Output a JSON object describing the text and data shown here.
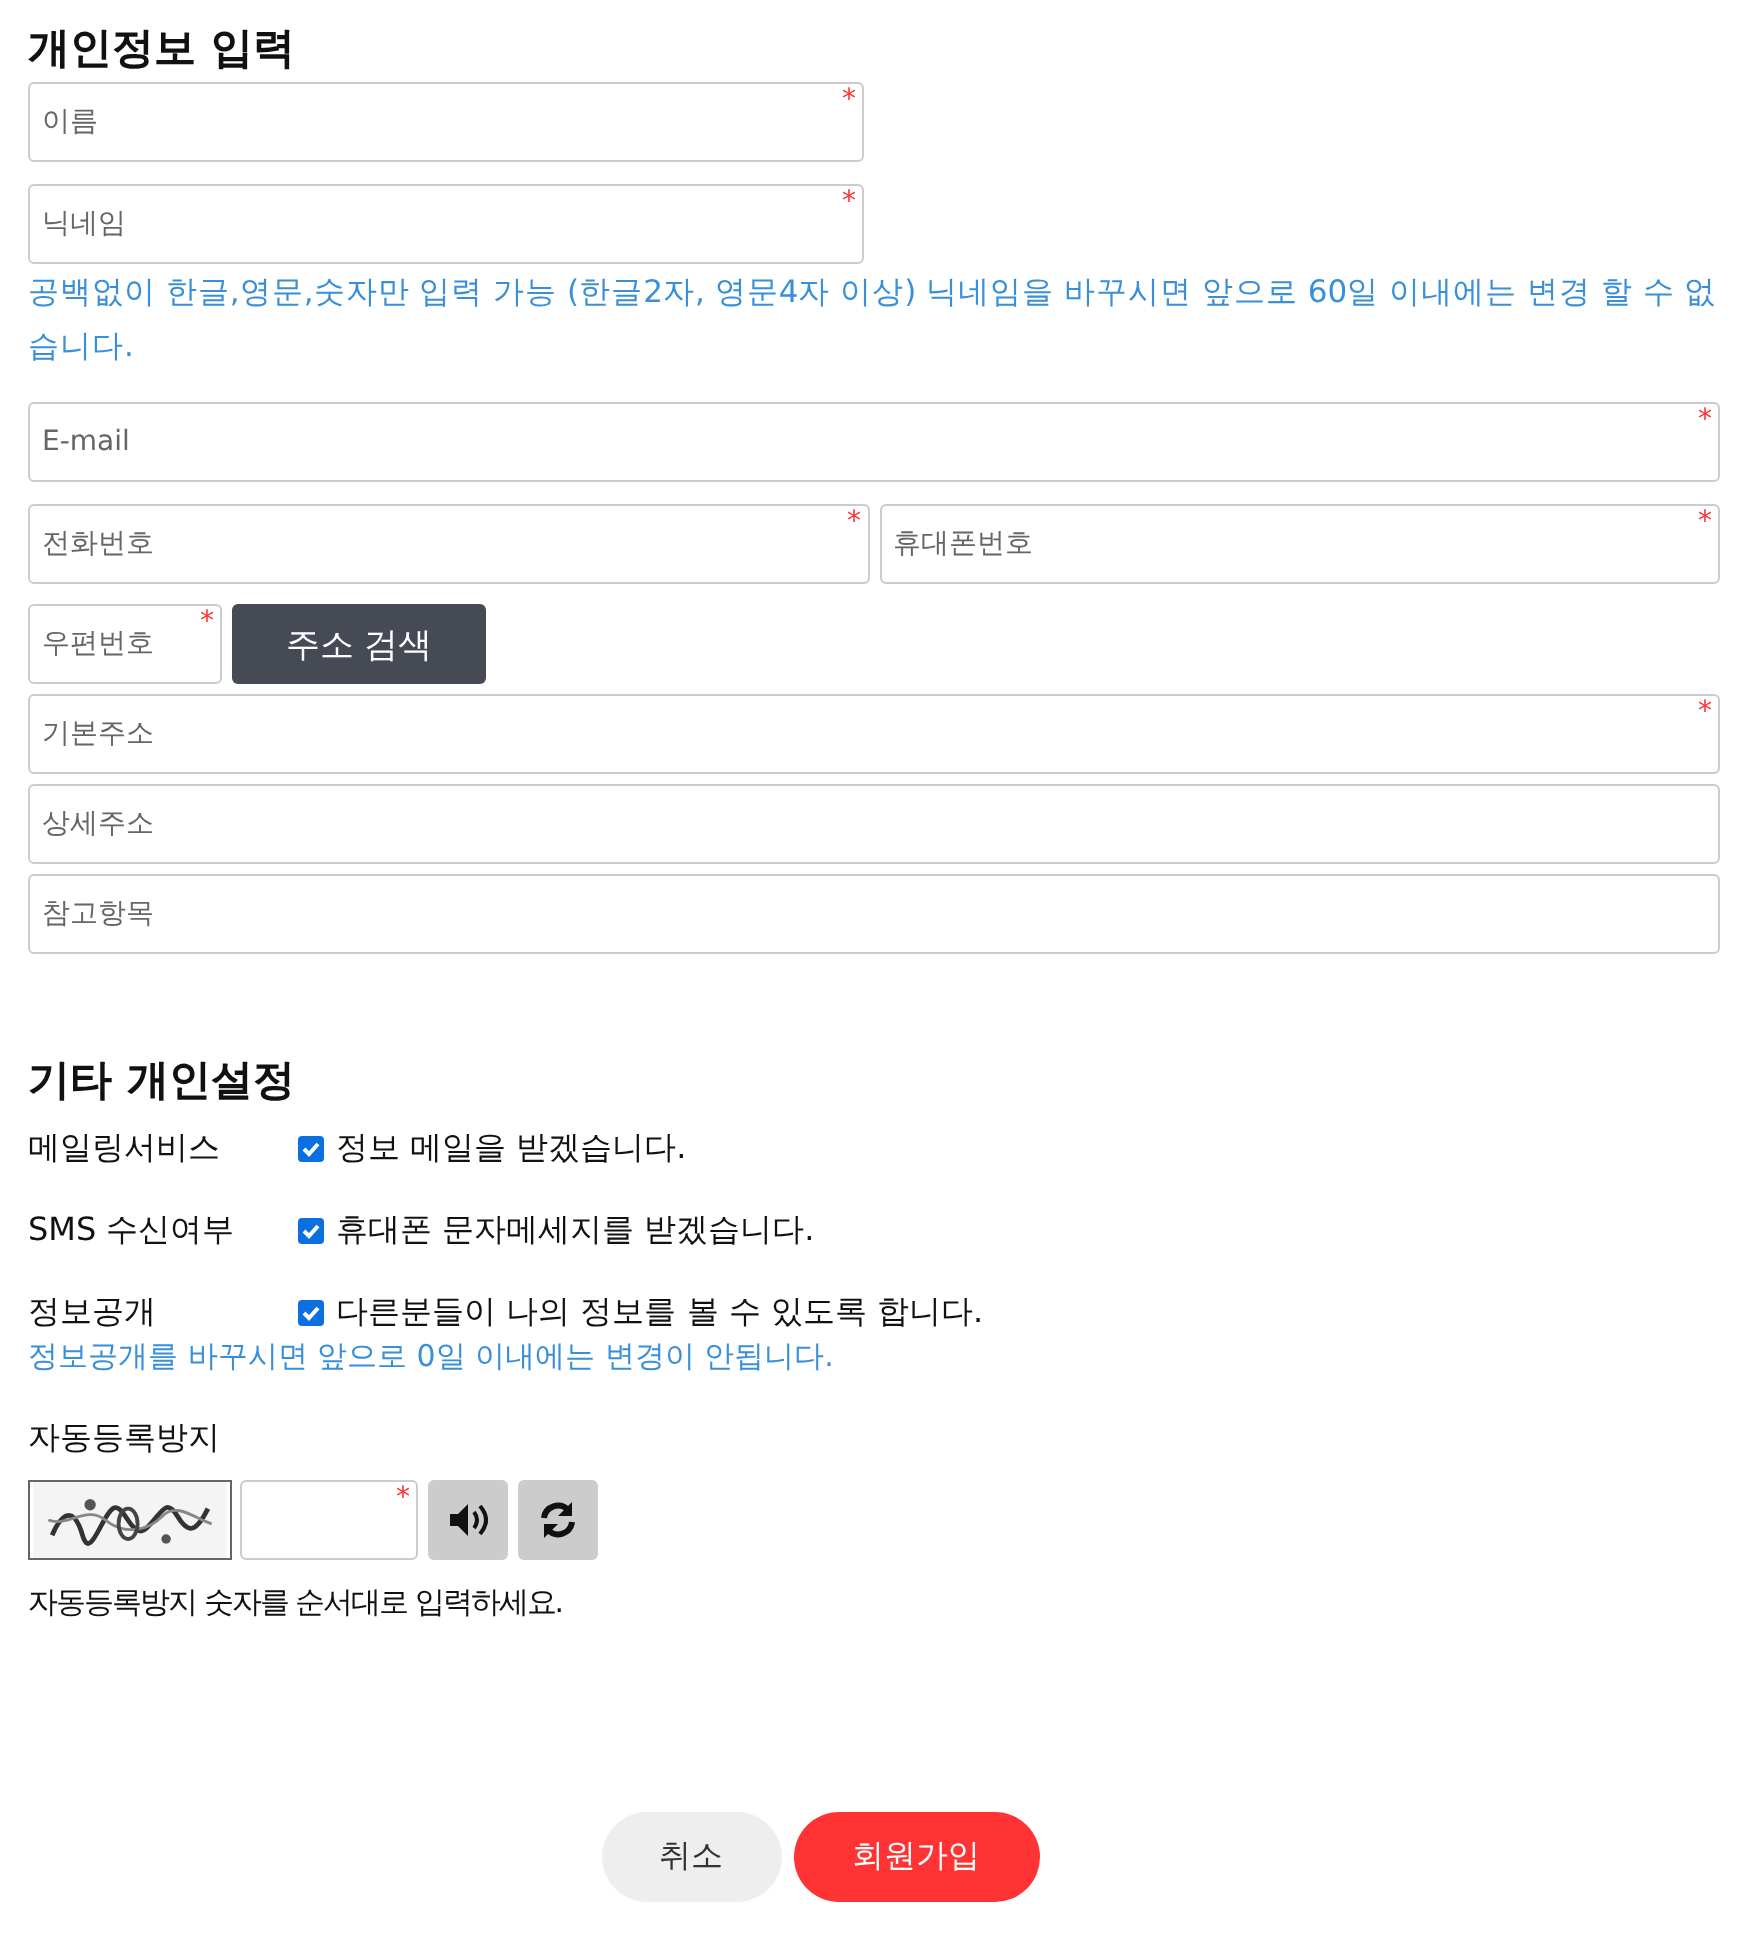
{
  "personal": {
    "title": "개인정보 입력",
    "name": {
      "placeholder": "이름",
      "required_mark": "*"
    },
    "nickname": {
      "placeholder": "닉네임",
      "required_mark": "*"
    },
    "nickname_hint": "공백없이 한글,영문,숫자만 입력 가능 (한글2자, 영문4자 이상) 닉네임을 바꾸시면 앞으로 60일 이내에는 변경 할 수 없습니다.",
    "email": {
      "placeholder": "E-mail",
      "required_mark": "*"
    },
    "phone": {
      "placeholder": "전화번호",
      "required_mark": "*"
    },
    "mobile": {
      "placeholder": "휴대폰번호",
      "required_mark": "*"
    },
    "zipcode": {
      "placeholder": "우편번호",
      "required_mark": "*"
    },
    "address_search_button": "주소 검색",
    "address1": {
      "placeholder": "기본주소",
      "required_mark": "*"
    },
    "address2": {
      "placeholder": "상세주소"
    },
    "address_ref": {
      "placeholder": "참고항목"
    }
  },
  "settings": {
    "title": "기타 개인설정",
    "options": [
      {
        "label": "메일링서비스",
        "text": "정보 메일을 받겠습니다.",
        "checked": true
      },
      {
        "label": "SMS 수신여부",
        "text": "휴대폰 문자메세지를 받겠습니다.",
        "checked": true
      },
      {
        "label": "정보공개",
        "text": "다른분들이 나의 정보를 볼 수 있도록 합니다.",
        "checked": true
      }
    ],
    "open_hint": "정보공개를 바꾸시면 앞으로 0일 이내에는 변경이 안됩니다."
  },
  "captcha": {
    "title": "자동등록방지",
    "input": {
      "required_mark": "*"
    },
    "hint": "자동등록방지 숫자를 순서대로 입력하세요."
  },
  "buttons": [
    {
      "label": "취소",
      "kind": "secondary"
    },
    {
      "label": "회원가입",
      "kind": "primary"
    }
  ]
}
